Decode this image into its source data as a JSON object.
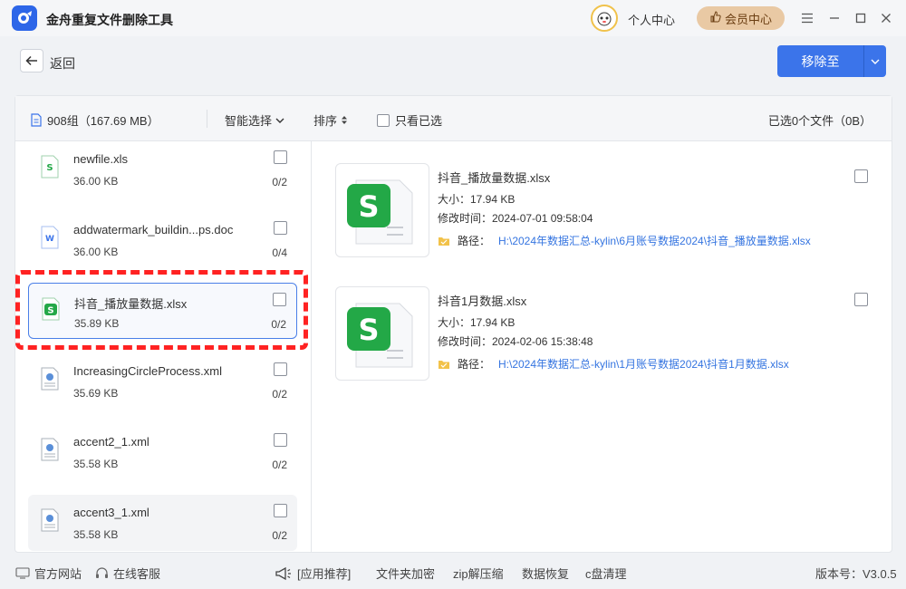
{
  "app": {
    "title": "金舟重复文件删除工具"
  },
  "header": {
    "personal": "个人中心",
    "vip": "会员中心"
  },
  "toolbar": {
    "back": "返回",
    "move": "移除至"
  },
  "panel": {
    "group_info": "908组（167.69 MB）",
    "smart_select": "智能选择",
    "sort": "排序",
    "only_selected": "只看已选",
    "selected_info": "已选0个文件（0B）"
  },
  "files": [
    {
      "name": "newfile.xls",
      "size": "36.00 KB",
      "count": "0/2",
      "icon": "excel-icon"
    },
    {
      "name": "addwatermark_buildin...ps.doc",
      "size": "36.00 KB",
      "count": "0/4",
      "icon": "word-icon"
    },
    {
      "name": "抖音_播放量数据.xlsx",
      "size": "35.89 KB",
      "count": "0/2",
      "icon": "excel-icon"
    },
    {
      "name": "IncreasingCircleProcess.xml",
      "size": "35.69 KB",
      "count": "0/2",
      "icon": "xml-icon"
    },
    {
      "name": "accent2_1.xml",
      "size": "35.58 KB",
      "count": "0/2",
      "icon": "xml-icon"
    },
    {
      "name": "accent3_1.xml",
      "size": "35.58 KB",
      "count": "0/2",
      "icon": "xml-icon"
    }
  ],
  "details": [
    {
      "name": "抖音_播放量数据.xlsx",
      "size": "大小：17.94 KB",
      "time": "修改时间：2024-07-01 09:58:04",
      "path_label": "路径：",
      "path": "H:\\2024年数据汇总-kylin\\6月账号数据2024\\抖音_播放量数据.xlsx"
    },
    {
      "name": "抖音1月数据.xlsx",
      "size": "大小：17.94 KB",
      "time": "修改时间：2024-02-06 15:38:48",
      "path_label": "路径：",
      "path": "H:\\2024年数据汇总-kylin\\1月账号数据2024\\抖音1月数据.xlsx"
    }
  ],
  "footer": {
    "website": "官方网站",
    "service": "在线客服",
    "recommend": "[应用推荐]",
    "links": [
      "文件夹加密",
      "zip解压缩",
      "数据恢复",
      "c盘清理"
    ],
    "version": "版本号：V3.0.5"
  },
  "colors": {
    "accent": "#3b74ea",
    "highlight": "#ff2222",
    "excel": "#23a847"
  }
}
